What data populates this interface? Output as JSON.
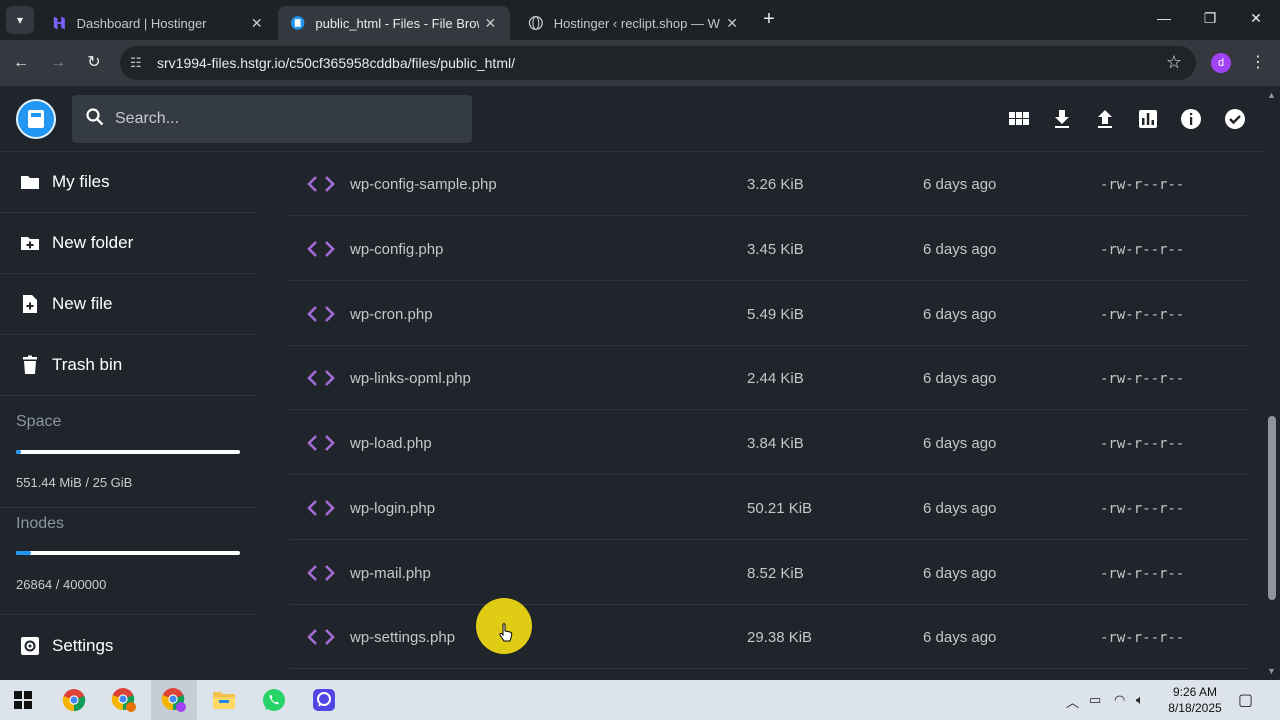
{
  "browser": {
    "tabs": [
      {
        "title": "Dashboard | Hostinger",
        "active": false
      },
      {
        "title": "public_html - Files - File Browser",
        "active": true
      },
      {
        "title": "Hostinger ‹ reclipt.shop — WordPress",
        "active": false
      }
    ],
    "url": "srv1994-files.hstgr.io/c50cf365958cddba/files/public_html/",
    "profile_initial": "d"
  },
  "header": {
    "search_placeholder": "Search..."
  },
  "sidebar": {
    "items": [
      {
        "label": "My files",
        "icon": "folder-icon"
      },
      {
        "label": "New folder",
        "icon": "create-folder-icon"
      },
      {
        "label": "New file",
        "icon": "note-add-icon"
      },
      {
        "label": "Trash bin",
        "icon": "trash-icon"
      }
    ],
    "space": {
      "title": "Space",
      "value": "551.44 MiB / 25 GiB",
      "fraction": 0.0215
    },
    "inodes": {
      "title": "Inodes",
      "value": "26864 / 400000",
      "fraction": 0.067
    },
    "settings_label": "Settings"
  },
  "files": [
    {
      "name": "wp-config-sample.php",
      "size": "3.26 KiB",
      "modified": "6 days ago",
      "perms": "-rw-r--r--"
    },
    {
      "name": "wp-config.php",
      "size": "3.45 KiB",
      "modified": "6 days ago",
      "perms": "-rw-r--r--"
    },
    {
      "name": "wp-cron.php",
      "size": "5.49 KiB",
      "modified": "6 days ago",
      "perms": "-rw-r--r--"
    },
    {
      "name": "wp-links-opml.php",
      "size": "2.44 KiB",
      "modified": "6 days ago",
      "perms": "-rw-r--r--"
    },
    {
      "name": "wp-load.php",
      "size": "3.84 KiB",
      "modified": "6 days ago",
      "perms": "-rw-r--r--"
    },
    {
      "name": "wp-login.php",
      "size": "50.21 KiB",
      "modified": "6 days ago",
      "perms": "-rw-r--r--"
    },
    {
      "name": "wp-mail.php",
      "size": "8.52 KiB",
      "modified": "6 days ago",
      "perms": "-rw-r--r--"
    },
    {
      "name": "wp-settings.php",
      "size": "29.38 KiB",
      "modified": "6 days ago",
      "perms": "-rw-r--r--"
    }
  ],
  "taskbar": {
    "time": "9:26 AM",
    "date": "8/18/2025"
  },
  "colors": {
    "accent": "#2196f3",
    "code_icon": "#a56bd8",
    "highlight": "#e0cc14"
  }
}
